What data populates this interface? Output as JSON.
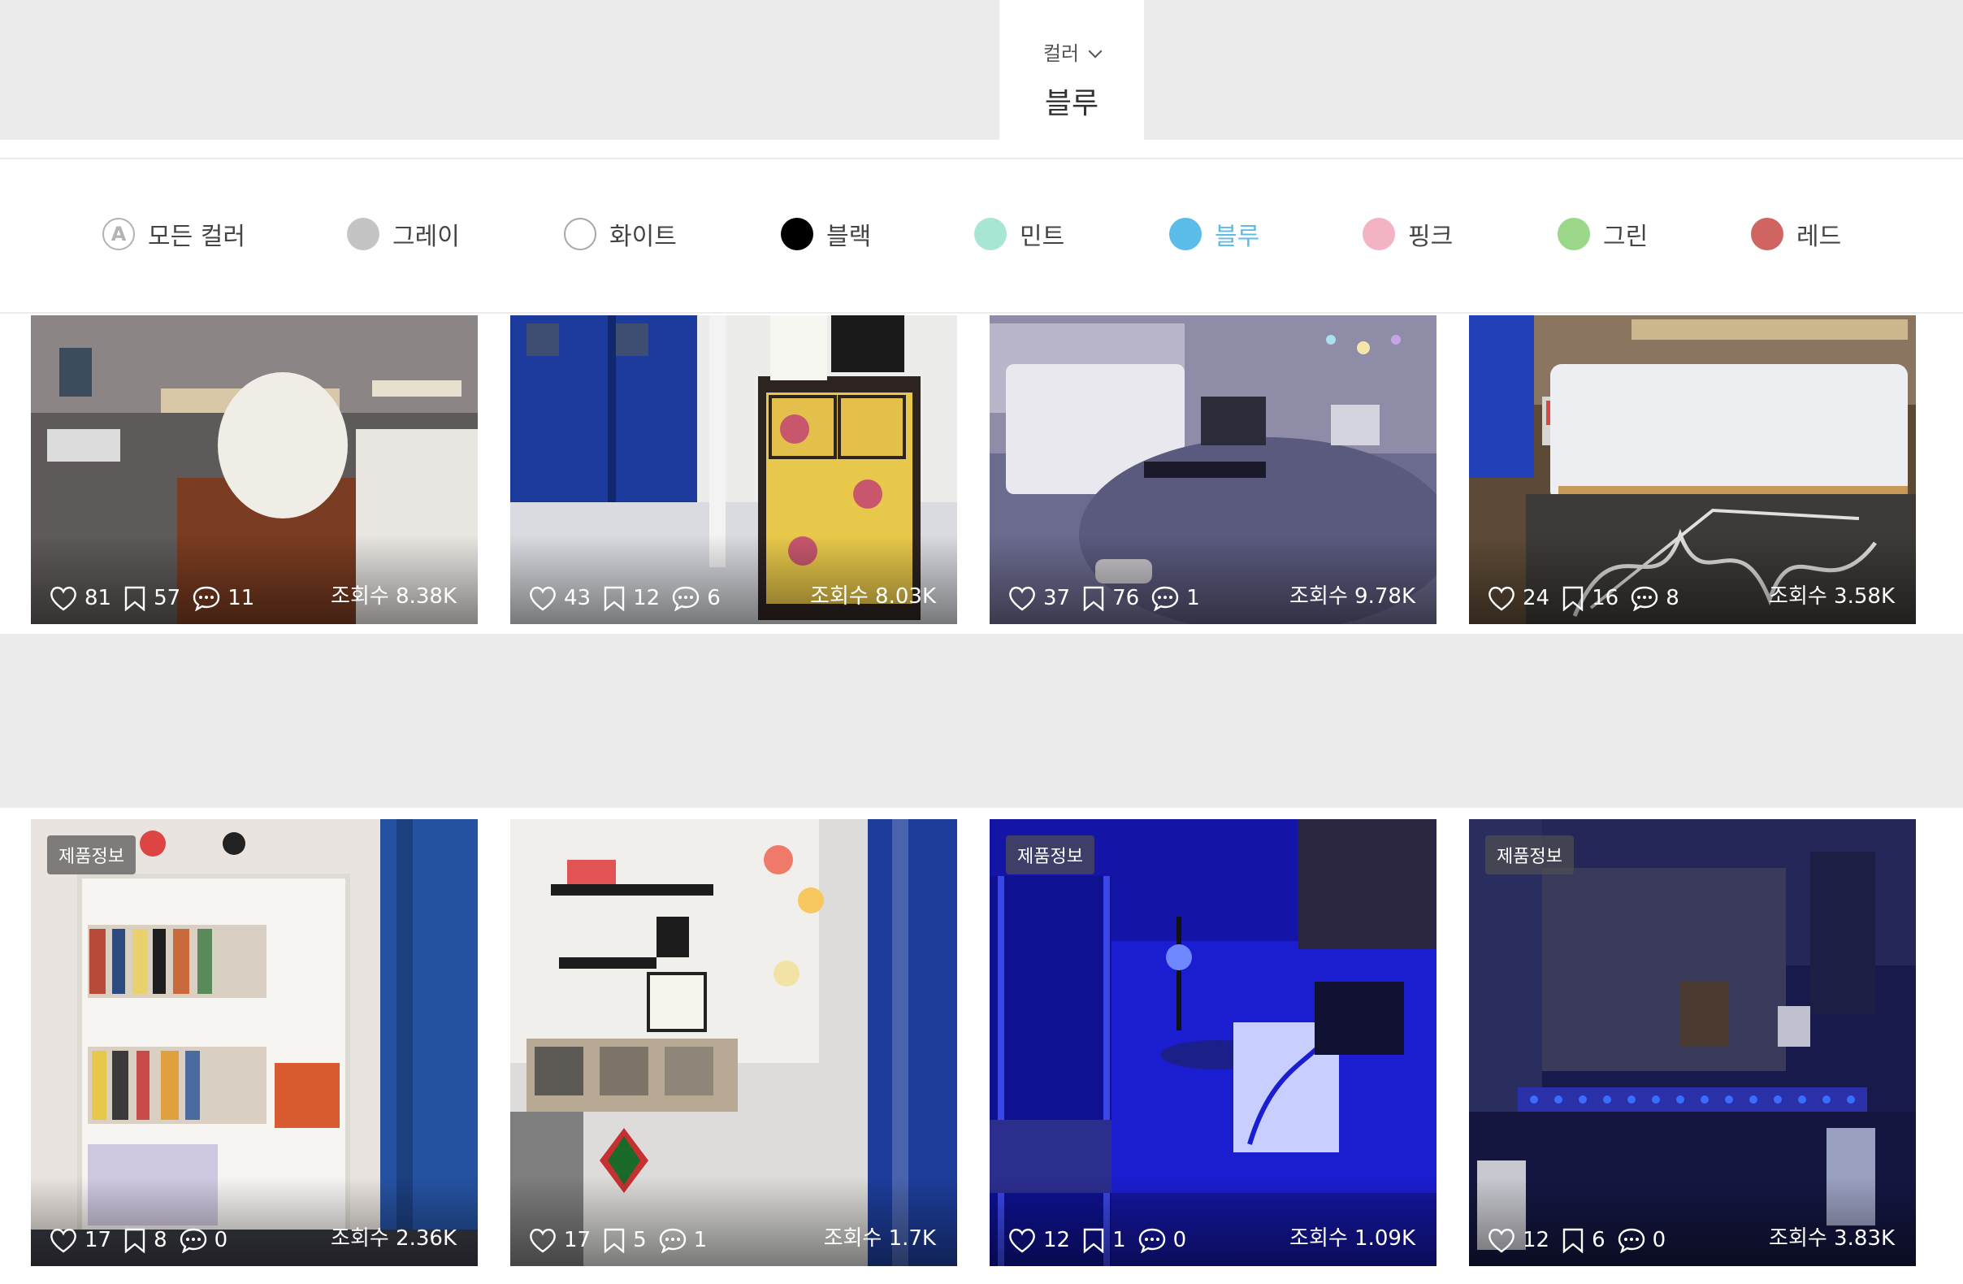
{
  "filter": {
    "tab_label": "컬러",
    "tab_value": "블루"
  },
  "colors": [
    {
      "label": "모든 컬러",
      "swatch": "all",
      "active": false
    },
    {
      "label": "그레이",
      "swatch": "#c4c4c4",
      "active": false
    },
    {
      "label": "화이트",
      "swatch": "#ffffff",
      "active": false
    },
    {
      "label": "블랙",
      "swatch": "#000000",
      "active": false
    },
    {
      "label": "민트",
      "swatch": "#a8e6d4",
      "active": false
    },
    {
      "label": "블루",
      "swatch": "#5bbcea",
      "active": true
    },
    {
      "label": "핑크",
      "swatch": "#f4b3c2",
      "active": false
    },
    {
      "label": "그린",
      "swatch": "#9bd789",
      "active": false
    },
    {
      "label": "레드",
      "swatch": "#cf6461",
      "active": false
    }
  ],
  "row1": [
    {
      "likes": "81",
      "scraps": "57",
      "comments": "11",
      "views": "조회수 8.38K",
      "badge": ""
    },
    {
      "likes": "43",
      "scraps": "12",
      "comments": "6",
      "views": "조회수 8.03K",
      "badge": ""
    },
    {
      "likes": "37",
      "scraps": "76",
      "comments": "1",
      "views": "조회수 9.78K",
      "badge": ""
    },
    {
      "likes": "24",
      "scraps": "16",
      "comments": "8",
      "views": "조회수 3.58K",
      "badge": ""
    }
  ],
  "row2": [
    {
      "likes": "17",
      "scraps": "8",
      "comments": "0",
      "views": "조회수 2.36K",
      "badge": "제품정보"
    },
    {
      "likes": "17",
      "scraps": "5",
      "comments": "1",
      "views": "조회수 1.7K",
      "badge": ""
    },
    {
      "likes": "12",
      "scraps": "1",
      "comments": "0",
      "views": "조회수 1.09K",
      "badge": "제품정보"
    },
    {
      "likes": "12",
      "scraps": "6",
      "comments": "0",
      "views": "조회수 3.83K",
      "badge": "제품정보"
    }
  ]
}
